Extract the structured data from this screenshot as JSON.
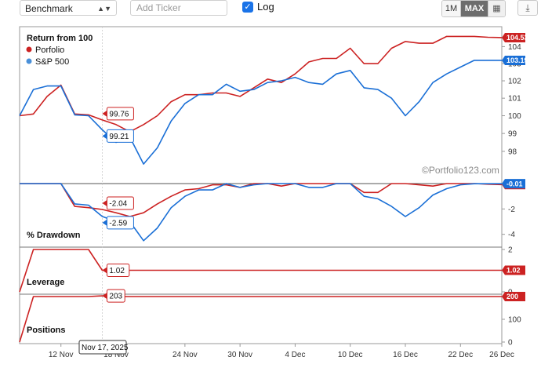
{
  "toolbar": {
    "benchmark_label": "Benchmark",
    "ticker_placeholder": "Add Ticker",
    "log_label": "Log",
    "log_checked": true,
    "range_1m": "1M",
    "range_max": "MAX",
    "range_selected": "MAX",
    "calendar_icon": "calendar-icon",
    "download_icon": "download-icon"
  },
  "watermark": "©Portfolio123.com",
  "colors": {
    "portfolio": "#cc2222",
    "benchmark": "#1a6fd6"
  },
  "hover": {
    "date_label": "Nov 17, 2025"
  },
  "chart_data": [
    {
      "type": "line",
      "title": "Return from 100",
      "yscale": "log",
      "ylim": [
        97,
        104.9
      ],
      "yticks": [
        98,
        99,
        100,
        101,
        102,
        103,
        104
      ],
      "x": [
        0,
        1,
        2,
        3,
        4,
        5,
        6,
        7,
        8,
        9,
        10,
        11,
        12,
        13,
        14,
        15,
        16,
        17,
        18,
        19,
        20,
        21,
        22,
        23,
        24,
        25,
        26,
        27,
        28,
        29,
        30,
        31,
        32,
        33,
        34,
        35
      ],
      "x_tick_positions": [
        3,
        7,
        12,
        16,
        20,
        24,
        28,
        32,
        35
      ],
      "x_tick_labels": [
        "12 Nov",
        "18 Nov",
        "24 Nov",
        "30 Nov",
        "4 Dec",
        "10 Dec",
        "16 Dec",
        "22 Dec",
        "26 Dec"
      ],
      "series": [
        {
          "name": "Porfolio",
          "color": "#cc2222",
          "values": [
            100,
            100.1,
            101.1,
            101.75,
            100.1,
            100.05,
            99.76,
            99.5,
            99.1,
            99.5,
            100,
            100.8,
            101.2,
            101.2,
            101.3,
            101.3,
            101.1,
            101.6,
            102.1,
            101.9,
            102.4,
            103.1,
            103.3,
            103.3,
            103.9,
            103.0,
            103.0,
            103.9,
            104.3,
            104.2,
            104.2,
            104.6,
            104.6,
            104.6,
            104.55,
            104.53
          ],
          "last_label": "104.53"
        },
        {
          "name": "S&P 500",
          "color": "#1a6fd6",
          "values": [
            100,
            101.5,
            101.7,
            101.7,
            100.05,
            100,
            99.21,
            98.5,
            98.8,
            97.3,
            98.2,
            99.7,
            100.7,
            101.2,
            101.2,
            101.8,
            101.4,
            101.5,
            101.9,
            102.0,
            102.2,
            101.9,
            101.8,
            102.4,
            102.6,
            101.6,
            101.5,
            101.0,
            100.0,
            100.8,
            101.9,
            102.4,
            102.8,
            103.19,
            103.19,
            103.19
          ],
          "last_label": "103.19"
        }
      ],
      "hover_values": {
        "portfolio": "99.76",
        "benchmark": "99.21"
      }
    },
    {
      "type": "line",
      "title": "% Drawdown",
      "ylim": [
        -4.7,
        0
      ],
      "yticks": [
        -2,
        -4
      ],
      "series": [
        {
          "name": "Porfolio",
          "color": "#cc2222",
          "values": [
            0,
            0,
            0,
            0,
            -1.8,
            -1.9,
            -2.04,
            -2.3,
            -2.6,
            -2.3,
            -1.6,
            -1.0,
            -0.5,
            -0.4,
            -0.1,
            -0.1,
            -0.3,
            0,
            0,
            -0.2,
            0,
            0,
            0,
            0,
            0,
            -0.7,
            -0.7,
            0,
            0,
            -0.1,
            -0.2,
            0,
            0,
            0,
            -0.05,
            -0.08
          ],
          "last_label": "-0.08"
        },
        {
          "name": "S&P 500",
          "color": "#1a6fd6",
          "values": [
            0,
            0,
            0,
            0,
            -1.6,
            -1.7,
            -2.59,
            -3.0,
            -3.0,
            -4.5,
            -3.5,
            -1.9,
            -1.0,
            -0.5,
            -0.5,
            0,
            -0.3,
            -0.1,
            0,
            0,
            0,
            -0.3,
            -0.3,
            0,
            0,
            -1.0,
            -1.2,
            -1.8,
            -2.6,
            -1.9,
            -0.9,
            -0.4,
            -0.1,
            -0.01,
            -0.01,
            -0.01
          ],
          "last_label": "-0.01"
        }
      ],
      "hover_values": {
        "portfolio": "-2.04",
        "benchmark": "-2.59"
      }
    },
    {
      "type": "line",
      "title": "Leverage",
      "ylim": [
        0,
        2
      ],
      "yticks": [
        0,
        1,
        2
      ],
      "series": [
        {
          "name": "Porfolio",
          "color": "#cc2222",
          "values": [
            0,
            2,
            2,
            2,
            2,
            2,
            1.02,
            1.02,
            1.02,
            1.02,
            1.02,
            1.02,
            1.02,
            1.02,
            1.02,
            1.02,
            1.02,
            1.02,
            1.02,
            1.02,
            1.02,
            1.02,
            1.02,
            1.02,
            1.02,
            1.02,
            1.02,
            1.02,
            1.02,
            1.02,
            1.02,
            1.02,
            1.02,
            1.02,
            1.02,
            1.02
          ],
          "last_label": "1.02"
        }
      ],
      "hover_values": {
        "portfolio": "1.02"
      }
    },
    {
      "type": "line",
      "title": "Positions",
      "ylim": [
        0,
        200
      ],
      "yticks": [
        0,
        100,
        200
      ],
      "series": [
        {
          "name": "Porfolio",
          "color": "#cc2222",
          "values": [
            0,
            200,
            200,
            200,
            200,
            200,
            203,
            200,
            200,
            200,
            200,
            200,
            200,
            200,
            200,
            200,
            200,
            200,
            200,
            200,
            200,
            200,
            200,
            200,
            200,
            200,
            200,
            200,
            200,
            200,
            200,
            200,
            200,
            200,
            200,
            200
          ],
          "last_label": "200"
        }
      ],
      "hover_values": {
        "portfolio": "203"
      }
    }
  ]
}
